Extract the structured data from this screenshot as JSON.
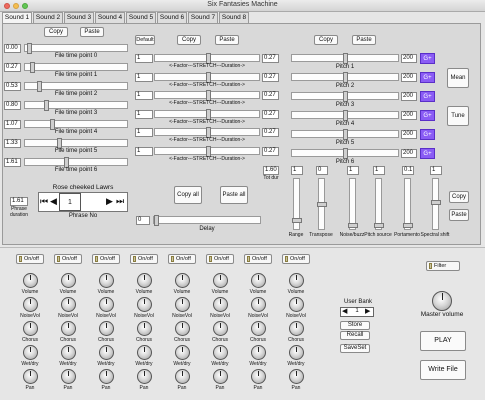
{
  "window": {
    "title": "Six Fantasies Machine"
  },
  "tabs": [
    "Sound 1",
    "Sound 2",
    "Sound 3",
    "Sound 4",
    "Sound 5",
    "Sound 6",
    "Sound 7",
    "Sound 8"
  ],
  "left": {
    "copy": "Copy",
    "paste": "Paste",
    "time_points": [
      {
        "value": "0.00",
        "label": "File time point 0",
        "pos": 0.02
      },
      {
        "value": "0.27",
        "label": "File time point 1",
        "pos": 0.05
      },
      {
        "value": "0.53",
        "label": "File time point 2",
        "pos": 0.12
      },
      {
        "value": "0.80",
        "label": "File time point 3",
        "pos": 0.19
      },
      {
        "value": "1.07",
        "label": "File time point 4",
        "pos": 0.26
      },
      {
        "value": "1.33",
        "label": "File time point 5",
        "pos": 0.33
      },
      {
        "value": "1.61",
        "label": "File time point 6",
        "pos": 0.4
      }
    ],
    "phrase_duration_value": "1.61",
    "phrase_duration_label": "Phrase duration",
    "phrase_name": "Rose cheeked Lawrs",
    "phrase_no_value": "1",
    "phrase_no_label": "Phrase No"
  },
  "middle": {
    "default": "Default",
    "copy": "Copy",
    "paste": "Paste",
    "factor_label": "<-Factor---STRETCH---Duration->",
    "rows": [
      {
        "factor": "1",
        "duration": "0.27"
      },
      {
        "factor": "1",
        "duration": "0.27"
      },
      {
        "factor": "1",
        "duration": "0.27"
      },
      {
        "factor": "1",
        "duration": "0.27"
      },
      {
        "factor": "1",
        "duration": "0.27"
      },
      {
        "factor": "1",
        "duration": "0.27"
      }
    ],
    "tot_dur_value": "1.60",
    "tot_dur_label": "Tot dur",
    "copy_all": "Copy all",
    "paste_all": "Paste all",
    "delay_value": "0",
    "delay_label": "Delay"
  },
  "right": {
    "copy": "Copy",
    "paste": "Paste",
    "pitches": [
      {
        "label": "Pitch 1",
        "value": "200",
        "btn": "G+"
      },
      {
        "label": "Pitch 2",
        "value": "200",
        "btn": "G+"
      },
      {
        "label": "Pitch 3",
        "value": "200",
        "btn": "G+"
      },
      {
        "label": "Pitch 4",
        "value": "200",
        "btn": "G+"
      },
      {
        "label": "Pitch 5",
        "value": "200",
        "btn": "G+"
      },
      {
        "label": "Pitch 6",
        "value": "200",
        "btn": "G+"
      }
    ],
    "mean": "Mean",
    "tune": "Tune",
    "vsliders": [
      {
        "value": "1",
        "label": "Range",
        "level": 0.15
      },
      {
        "value": "0",
        "label": "Transpose",
        "level": 0.5
      },
      {
        "value": "1",
        "label": "Noise/buzz",
        "level": 0.05
      },
      {
        "value": "1",
        "label": "Pitch source",
        "level": 0.05
      },
      {
        "value": "0.1",
        "label": "Portamento",
        "level": 0.05
      },
      {
        "value": "1",
        "label": "Spectral shift",
        "level": 0.55
      }
    ],
    "copy2": "Copy",
    "paste2": "Paste"
  },
  "mixer": {
    "onoff_label": "On/off",
    "knob_rows": [
      "Volume",
      "NoiseVol",
      "Chorus",
      "Wet/dry",
      "Pan"
    ],
    "channels": 8,
    "filter": "Filter",
    "user_bank_label": "User Bank",
    "user_bank_value": "1",
    "store": "Store",
    "recall": "Recall",
    "save_set": "SaveSet",
    "master_volume": "Master volume",
    "play": "PLAY",
    "write_file": "Write File"
  }
}
